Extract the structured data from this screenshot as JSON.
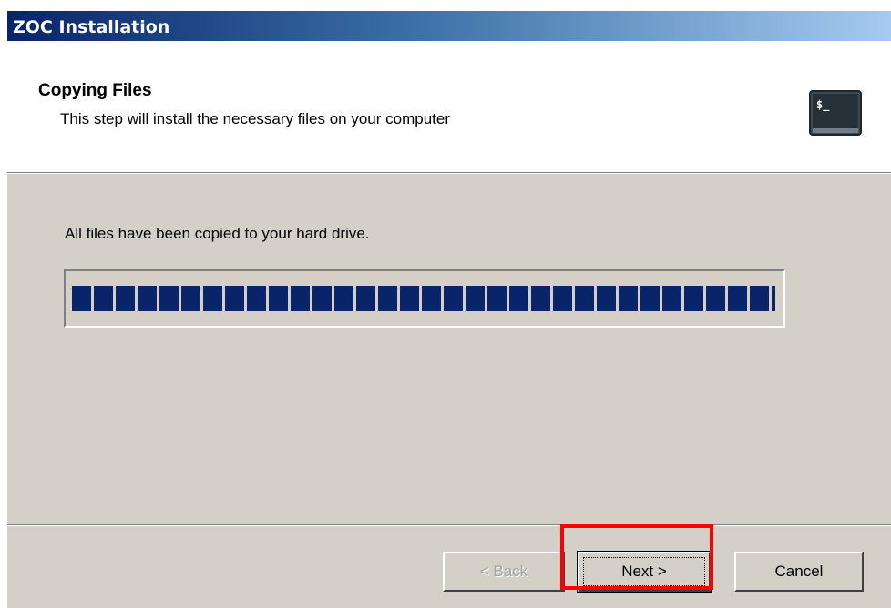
{
  "window": {
    "title": "ZOC Installation"
  },
  "header": {
    "title": "Copying Files",
    "subtitle": "This step will install the necessary files on your computer",
    "icon": "terminal-icon",
    "icon_text": "$_"
  },
  "main": {
    "status_text": "All files have been copied to your hard drive.",
    "progress": {
      "value_percent": 100
    }
  },
  "buttons": {
    "back_label": "< Back",
    "next_label": "Next >",
    "cancel_label": "Cancel"
  },
  "colors": {
    "titlebar_start": "#0a246a",
    "titlebar_end": "#a6caf0",
    "progress_block": "#0a246a",
    "dialog_bg": "#d4d0c8",
    "highlight": "#ff0000"
  }
}
